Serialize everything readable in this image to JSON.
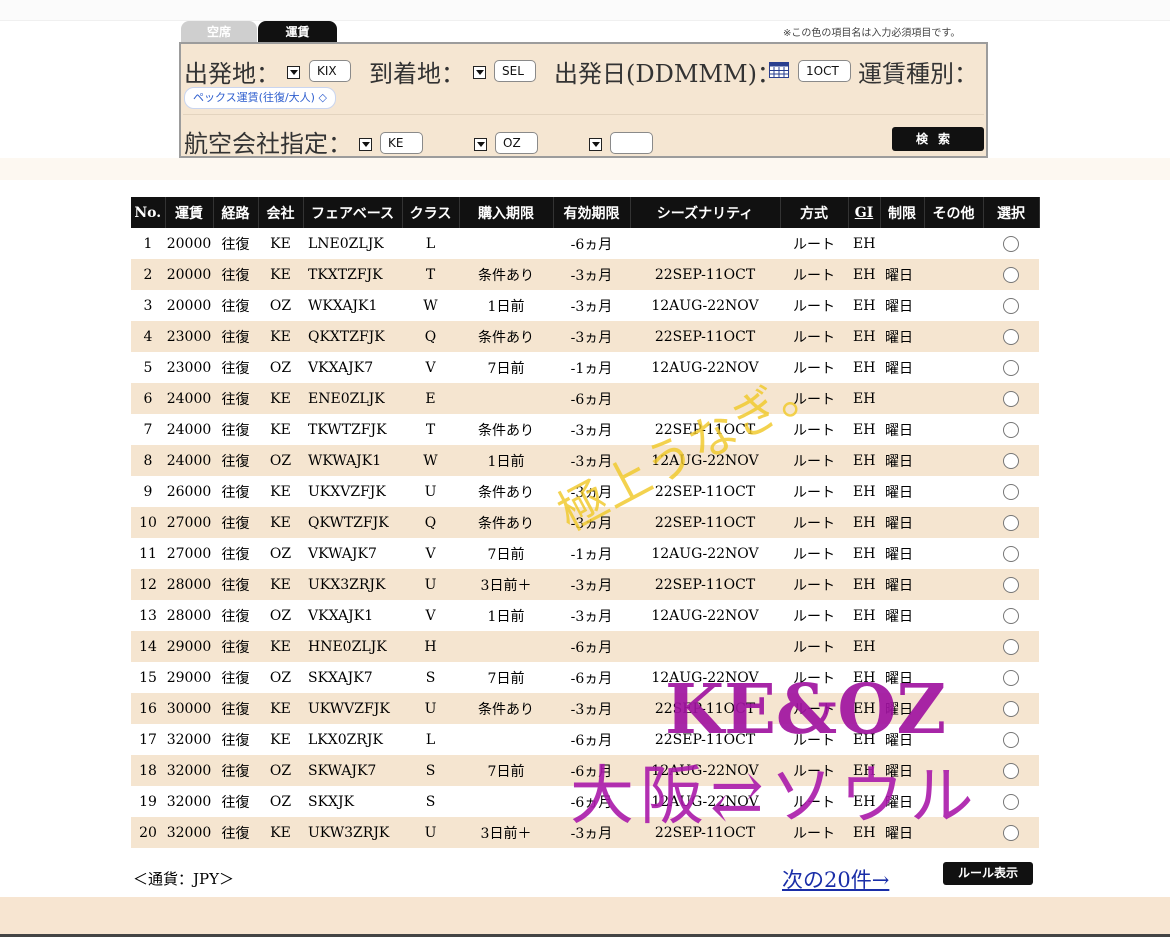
{
  "tabs": [
    {
      "label": "空席",
      "active": false
    },
    {
      "label": "運賃",
      "active": true
    }
  ],
  "required_note": "※この色の項目名は入力必須項目です。",
  "form": {
    "origin_label": "出発地：",
    "origin_value": "KIX",
    "destination_label": "到着地：",
    "destination_value": "SEL",
    "date_label": "出発日(DDMMM)：",
    "date_value": "1OCT",
    "fare_type_label": "運賃種別：",
    "fare_type_value": "ペックス運賃(往復/大人) ◇",
    "airline_label": "航空会社指定：",
    "airline_values": [
      "KE",
      "OZ",
      ""
    ],
    "search_button": "検索"
  },
  "table": {
    "headers": [
      "No.",
      "運賃",
      "経路",
      "会社",
      "フェアベース",
      "クラス",
      "購入期限",
      "有効期限",
      "シーズナリティ",
      "方式",
      "GI",
      "制限",
      "その他",
      "選択"
    ],
    "rows": [
      [
        "1",
        "20000",
        "往復",
        "KE",
        "LNE0ZLJK",
        "L",
        "",
        "-6ヵ月",
        "",
        "ルート",
        "EH",
        "",
        ""
      ],
      [
        "2",
        "20000",
        "往復",
        "KE",
        "TKXTZFJK",
        "T",
        "条件あり",
        "-3ヵ月",
        "22SEP-11OCT",
        "ルート",
        "EH",
        "曜日",
        ""
      ],
      [
        "3",
        "20000",
        "往復",
        "OZ",
        "WKXAJK1",
        "W",
        "1日前",
        "-3ヵ月",
        "12AUG-22NOV",
        "ルート",
        "EH",
        "曜日",
        ""
      ],
      [
        "4",
        "23000",
        "往復",
        "KE",
        "QKXTZFJK",
        "Q",
        "条件あり",
        "-3ヵ月",
        "22SEP-11OCT",
        "ルート",
        "EH",
        "曜日",
        ""
      ],
      [
        "5",
        "23000",
        "往復",
        "OZ",
        "VKXAJK7",
        "V",
        "7日前",
        "-1ヵ月",
        "12AUG-22NOV",
        "ルート",
        "EH",
        "曜日",
        ""
      ],
      [
        "6",
        "24000",
        "往復",
        "KE",
        "ENE0ZLJK",
        "E",
        "",
        "-6ヵ月",
        "",
        "ルート",
        "EH",
        "",
        ""
      ],
      [
        "7",
        "24000",
        "往復",
        "KE",
        "TKWTZFJK",
        "T",
        "条件あり",
        "-3ヵ月",
        "22SEP-11OCT",
        "ルート",
        "EH",
        "曜日",
        ""
      ],
      [
        "8",
        "24000",
        "往復",
        "OZ",
        "WKWAJK1",
        "W",
        "1日前",
        "-3ヵ月",
        "12AUG-22NOV",
        "ルート",
        "EH",
        "曜日",
        ""
      ],
      [
        "9",
        "26000",
        "往復",
        "KE",
        "UKXVZFJK",
        "U",
        "条件あり",
        "-3ヵ月",
        "22SEP-11OCT",
        "ルート",
        "EH",
        "曜日",
        ""
      ],
      [
        "10",
        "27000",
        "往復",
        "KE",
        "QKWTZFJK",
        "Q",
        "条件あり",
        "-3ヵ月",
        "22SEP-11OCT",
        "ルート",
        "EH",
        "曜日",
        ""
      ],
      [
        "11",
        "27000",
        "往復",
        "OZ",
        "VKWAJK7",
        "V",
        "7日前",
        "-1ヵ月",
        "12AUG-22NOV",
        "ルート",
        "EH",
        "曜日",
        ""
      ],
      [
        "12",
        "28000",
        "往復",
        "KE",
        "UKX3ZRJK",
        "U",
        "3日前＋",
        "-3ヵ月",
        "22SEP-11OCT",
        "ルート",
        "EH",
        "曜日",
        ""
      ],
      [
        "13",
        "28000",
        "往復",
        "OZ",
        "VKXAJK1",
        "V",
        "1日前",
        "-3ヵ月",
        "12AUG-22NOV",
        "ルート",
        "EH",
        "曜日",
        ""
      ],
      [
        "14",
        "29000",
        "往復",
        "KE",
        "HNE0ZLJK",
        "H",
        "",
        "-6ヵ月",
        "",
        "ルート",
        "EH",
        "",
        ""
      ],
      [
        "15",
        "29000",
        "往復",
        "OZ",
        "SKXAJK7",
        "S",
        "7日前",
        "-6ヵ月",
        "12AUG-22NOV",
        "ルート",
        "EH",
        "曜日",
        ""
      ],
      [
        "16",
        "30000",
        "往復",
        "KE",
        "UKWVZFJK",
        "U",
        "条件あり",
        "-3ヵ月",
        "22SEP-11OCT",
        "ルート",
        "EH",
        "曜日",
        ""
      ],
      [
        "17",
        "32000",
        "往復",
        "KE",
        "LKX0ZRJK",
        "L",
        "",
        "-6ヵ月",
        "22SEP-11OCT",
        "ルート",
        "EH",
        "曜日",
        ""
      ],
      [
        "18",
        "32000",
        "往復",
        "OZ",
        "SKWAJK7",
        "S",
        "7日前",
        "-6ヵ月",
        "12AUG-22NOV",
        "ルート",
        "EH",
        "曜日",
        ""
      ],
      [
        "19",
        "32000",
        "往復",
        "OZ",
        "SKXJK",
        "S",
        "",
        "-6ヵ月",
        "12AUG-22NOV",
        "ルート",
        "EH",
        "曜日",
        ""
      ],
      [
        "20",
        "32000",
        "往復",
        "KE",
        "UKW3ZRJK",
        "U",
        "3日前＋",
        "-3ヵ月",
        "22SEP-11OCT",
        "ルート",
        "EH",
        "曜日",
        ""
      ]
    ]
  },
  "footer": {
    "currency": "＜通貨：JPY＞",
    "next_link": "次の20件→",
    "rule_button": "ルール表示"
  },
  "overlays": {
    "stamp": "極上うなぎ。",
    "airlines": "KE&OZ",
    "route": "大阪⇄ソウル"
  }
}
